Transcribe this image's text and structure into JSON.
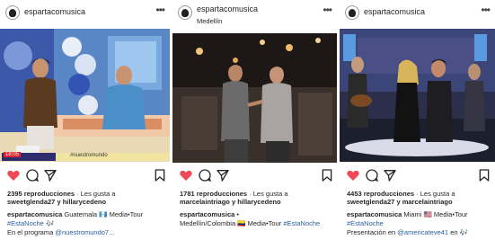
{
  "posts": [
    {
      "username": "espartacomusica",
      "location": "",
      "views": "2395 reproducciones",
      "likes_prefix": "· Les gusta a",
      "likers": "sweetglenda27 y hillarycedeno",
      "caption_user": "espartacomusica",
      "caption_text": "Guatemala 🇬🇹 Media•Tour",
      "hashtag_line": "#EstaNoche 🎶",
      "program_line_prefix": "En el programa",
      "program_mention": "@nuestromundo7...",
      "media_caption": "#nuestromundo",
      "media_clock": "18:05"
    },
    {
      "username": "espartacomusica",
      "location": "Medellín",
      "views": "1781 reproducciones",
      "likes_prefix": "· Les gusta a",
      "likers": "marcelaintriago y hillarycedeno",
      "caption_user": "espartacomusica",
      "caption_text": "•",
      "caption_line2": "Medellín/Colombia 🇨🇴 Media•Tour",
      "hashtag": "#EstaNoche"
    },
    {
      "username": "espartacomusica",
      "location": "",
      "views": "4453 reproducciones",
      "likes_prefix": "· Les gusta a",
      "likers": "sweetglenda27 y marcelaintriago",
      "caption_user": "espartacomusica",
      "caption_text": "Miami 🇺🇸 Media•Tour",
      "hashtag_line": "#EstaNoche",
      "presentation_prefix": "Presentación en",
      "presentation_mention": "@americateve41",
      "presentation_suffix": "en 🎶"
    }
  ],
  "icons": [
    "heart-icon",
    "comment-icon",
    "share-icon",
    "bookmark-icon",
    "more-icon"
  ],
  "colors": {
    "like_red": "#ed4956",
    "link_blue": "#2a5f9e"
  }
}
